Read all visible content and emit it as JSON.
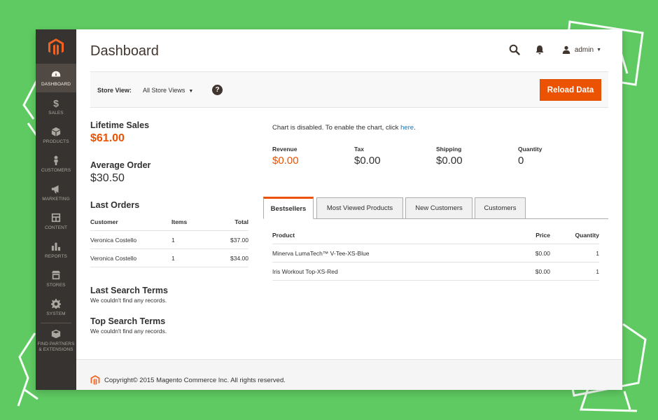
{
  "colors": {
    "accent": "#eb5202",
    "sidebar": "#373330",
    "link": "#1979c3",
    "background": "#5fca62"
  },
  "sidebar": {
    "logo_icon": "magento-logo-icon",
    "items": [
      {
        "label": "DASHBOARD",
        "icon": "dashboard-icon"
      },
      {
        "label": "SALES",
        "icon": "dollar-icon"
      },
      {
        "label": "PRODUCTS",
        "icon": "cube-icon"
      },
      {
        "label": "CUSTOMERS",
        "icon": "person-icon"
      },
      {
        "label": "MARKETING",
        "icon": "megaphone-icon"
      },
      {
        "label": "CONTENT",
        "icon": "layout-icon"
      },
      {
        "label": "REPORTS",
        "icon": "bar-chart-icon"
      },
      {
        "label": "STORES",
        "icon": "store-icon"
      },
      {
        "label": "SYSTEM",
        "icon": "gear-icon"
      },
      {
        "label": "FIND PARTNERS & EXTENSIONS",
        "icon": "box-icon"
      }
    ]
  },
  "header": {
    "title": "Dashboard",
    "user": "admin"
  },
  "store_bar": {
    "label": "Store View:",
    "selected": "All Store Views",
    "help": "?",
    "reload": "Reload Data"
  },
  "stats": {
    "lifetime_label": "Lifetime Sales",
    "lifetime_value": "$61.00",
    "average_label": "Average Order",
    "average_value": "$30.50"
  },
  "last_orders": {
    "title": "Last Orders",
    "columns": [
      "Customer",
      "Items",
      "Total"
    ],
    "rows": [
      {
        "customer": "Veronica Costello",
        "items": "1",
        "total": "$37.00"
      },
      {
        "customer": "Veronica Costello",
        "items": "1",
        "total": "$34.00"
      }
    ]
  },
  "last_search": {
    "title": "Last Search Terms",
    "empty": "We couldn't find any records."
  },
  "top_search": {
    "title": "Top Search Terms",
    "empty": "We couldn't find any records."
  },
  "chart": {
    "message": "Chart is disabled. To enable the chart, click ",
    "link": "here",
    "period": "."
  },
  "totals": [
    {
      "label": "Revenue",
      "value": "$0.00"
    },
    {
      "label": "Tax",
      "value": "$0.00"
    },
    {
      "label": "Shipping",
      "value": "$0.00"
    },
    {
      "label": "Quantity",
      "value": "0"
    }
  ],
  "tabs": [
    "Bestsellers",
    "Most Viewed Products",
    "New Customers",
    "Customers"
  ],
  "bestsellers": {
    "columns": [
      "Product",
      "Price",
      "Quantity"
    ],
    "rows": [
      {
        "product": "Minerva LumaTech™ V-Tee-XS-Blue",
        "price": "$0.00",
        "quantity": "1"
      },
      {
        "product": "Iris Workout Top-XS-Red",
        "price": "$0.00",
        "quantity": "1"
      }
    ]
  },
  "footer": {
    "copyright": "Copyright© 2015 Magento Commerce Inc. All rights reserved."
  }
}
